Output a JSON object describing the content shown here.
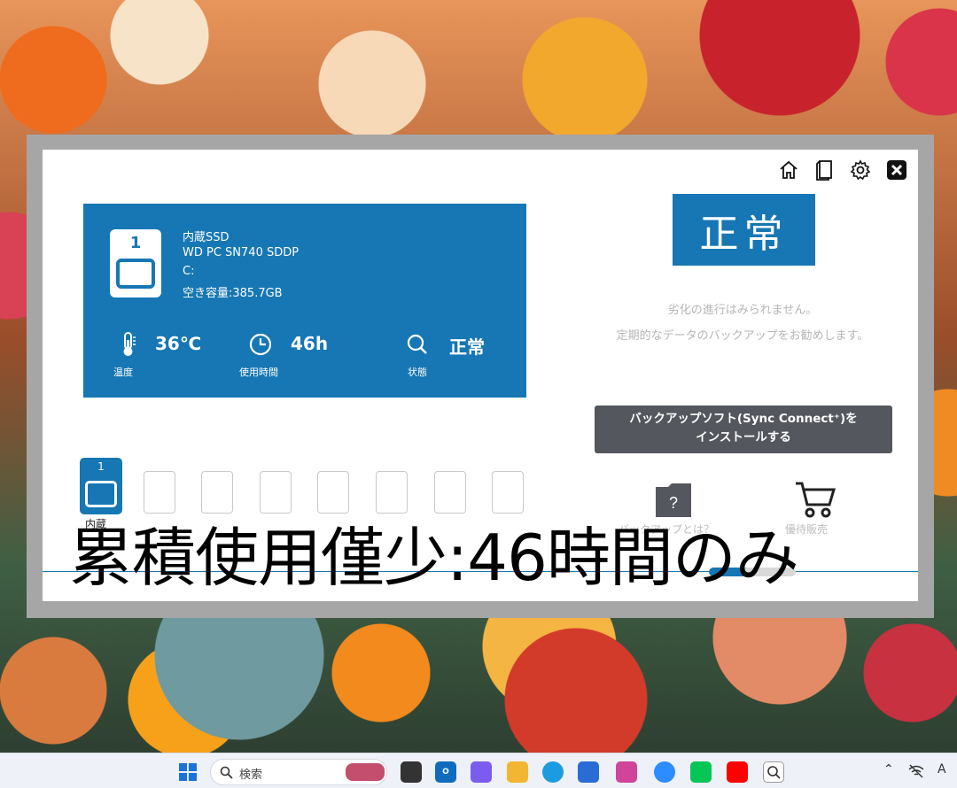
{
  "colors": {
    "accent": "#1677b4",
    "button_dark": "#54575e",
    "message_gray": "#b5b5b5"
  },
  "toolbar": {
    "icons": [
      "home-icon",
      "manual-book-icon",
      "settings-gear-icon",
      "close-icon"
    ]
  },
  "drive": {
    "slot_number": "1",
    "type": "内蔵SSD",
    "model": "WD PC SN740 SDDP",
    "volume": "C:",
    "free_space": "空き容量:385.7GB",
    "temperature": {
      "value": "36℃",
      "label": "温度"
    },
    "usage_time": {
      "value": "46h",
      "label": "使用時間"
    },
    "condition": {
      "value": "正常",
      "label": "状態"
    }
  },
  "status": {
    "badge": "正常",
    "message_1": "劣化の進行はみられません。",
    "message_2": "定期的なデータのバックアップをお勧めします。"
  },
  "install_button": {
    "line_1": "バックアップソフト(Sync Connect⁺)を",
    "line_2": "インストールする"
  },
  "slots": {
    "active_number": "1",
    "active_label": "内蔵",
    "empty_count": 7
  },
  "tools": {
    "backup_info_partial": "バックアップとは？",
    "shop_partial": "優待販売"
  },
  "caption": "累積使用僅少:46時間のみ",
  "taskbar": {
    "search_placeholder": "検索",
    "ime_indicator": "A"
  }
}
